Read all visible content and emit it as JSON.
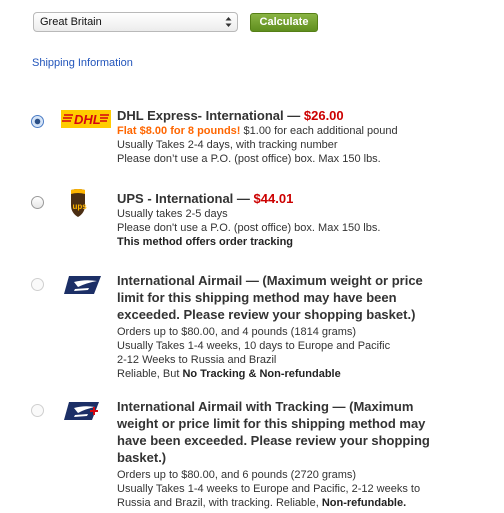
{
  "controls": {
    "country_selected": "Great Britain",
    "calculate_label": "Calculate",
    "shipping_info_link": "Shipping Information"
  },
  "options": [
    {
      "carrier": "DHL",
      "logo_text": "DHL",
      "title": "DHL Express- International",
      "separator": " — ",
      "price": "$26.00",
      "promo": "Flat $8.00 for 8 pounds!",
      "promo_rest": " $1.00 for each additional pound",
      "lines": [
        "Usually Takes 2-4 days, with tracking number",
        "Please don’t use a P.O. (post office) box. Max 150 lbs."
      ],
      "selected": true,
      "disabled": false
    },
    {
      "carrier": "UPS",
      "logo_text": "ups",
      "title": "UPS - International",
      "separator": " — ",
      "price": "$44.01",
      "lines": [
        "Usually takes 2-5 days",
        "Please don't use a P.O. (post office) box. Max 150 lbs."
      ],
      "bold_line": "This method offers order tracking",
      "selected": false,
      "disabled": false
    },
    {
      "carrier": "USPS",
      "title_lines": [
        "International Airmail — (Maximum weight or price",
        "limit for this shipping method may have been",
        "exceeded. Please review your shopping basket.)"
      ],
      "lines": [
        "Orders up to $80.00, and 4 pounds (1814 grams)",
        "Usually Takes 1-4 weeks, 10 days to Europe and Pacific",
        "2-12 Weeks to Russia and Brazil"
      ],
      "last_line_plain": "Reliable, But ",
      "last_line_bold": "No Tracking & Non-refundable",
      "selected": false,
      "disabled": true
    },
    {
      "carrier": "USPS",
      "title_lines": [
        "International Airmail with Tracking — (Maximum",
        "weight or price limit for this shipping method may",
        "have been exceeded. Please review your shopping",
        "basket.)"
      ],
      "lines": [
        "Orders up to $80.00, and 6 pounds (2720 grams)",
        "Usually Takes 1-4 weeks to Europe and Pacific, 2-12 weeks to"
      ],
      "last_line_plain": "Russia and Brazil, with tracking. Reliable, ",
      "last_line_bold": "Non-refundable.",
      "selected": false,
      "disabled": true
    }
  ],
  "colors": {
    "price": "#cc0000",
    "promo": "#ff6600",
    "button": "#6a9a25",
    "link": "#2255bb",
    "dhl_yellow": "#ffcc00",
    "dhl_red": "#d40511",
    "ups_brown": "#4b2e13",
    "usps_navy": "#1c2f66"
  }
}
